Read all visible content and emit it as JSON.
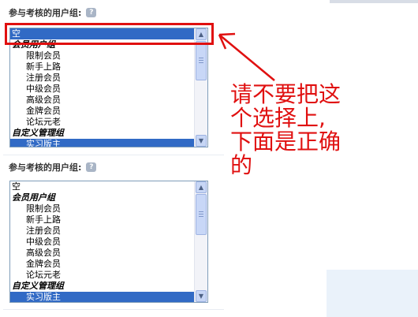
{
  "sections": [
    {
      "label": "参与考核的用户组:",
      "help_icon": "?",
      "options": [
        {
          "text": "空",
          "kind": "plain",
          "selected": true
        },
        {
          "text": "会员用户组",
          "kind": "group"
        },
        {
          "text": "限制会员",
          "kind": "child"
        },
        {
          "text": "新手上路",
          "kind": "child"
        },
        {
          "text": "注册会员",
          "kind": "child"
        },
        {
          "text": "中级会员",
          "kind": "child"
        },
        {
          "text": "高级会员",
          "kind": "child"
        },
        {
          "text": "金牌会员",
          "kind": "child"
        },
        {
          "text": "论坛元老",
          "kind": "child"
        },
        {
          "text": "自定义管理组",
          "kind": "group"
        },
        {
          "text": "实习版主",
          "kind": "child",
          "selected": true
        }
      ]
    },
    {
      "label": "参与考核的用户组:",
      "help_icon": "?",
      "options": [
        {
          "text": "空",
          "kind": "plain"
        },
        {
          "text": "会员用户组",
          "kind": "group"
        },
        {
          "text": "限制会员",
          "kind": "child"
        },
        {
          "text": "新手上路",
          "kind": "child"
        },
        {
          "text": "注册会员",
          "kind": "child"
        },
        {
          "text": "中级会员",
          "kind": "child"
        },
        {
          "text": "高级会员",
          "kind": "child"
        },
        {
          "text": "金牌会员",
          "kind": "child"
        },
        {
          "text": "论坛元老",
          "kind": "child"
        },
        {
          "text": "自定义管理组",
          "kind": "group"
        },
        {
          "text": "实习版主",
          "kind": "child",
          "selected": true
        }
      ]
    }
  ],
  "annotation": {
    "text_lines": [
      "请不要把这",
      "个选择上,",
      "下面是正确",
      "的"
    ],
    "color": "#e01010"
  },
  "colors": {
    "selection": "#316ac5",
    "listbox_border": "#7f9db9"
  }
}
